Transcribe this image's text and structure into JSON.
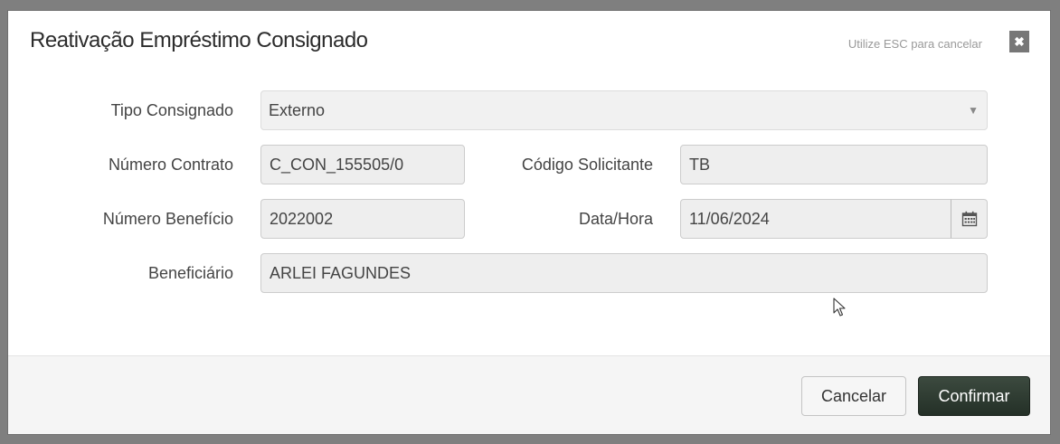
{
  "dialog": {
    "title": "Reativação Empréstimo Consignado",
    "esc_hint": "Utilize ESC para cancelar",
    "close_icon": "close-icon"
  },
  "form": {
    "tipo_consignado": {
      "label": "Tipo Consignado",
      "value": "Externo"
    },
    "numero_contrato": {
      "label": "Número Contrato",
      "value": "C_CON_155505/0"
    },
    "codigo_solicitante": {
      "label": "Código Solicitante",
      "value": "TB"
    },
    "numero_beneficio": {
      "label": "Número Benefício",
      "value": "2022002"
    },
    "data_hora": {
      "label": "Data/Hora",
      "value": "11/06/2024",
      "icon": "calendar-icon"
    },
    "beneficiario": {
      "label": "Beneficiário",
      "value": "ARLEI FAGUNDES"
    }
  },
  "footer": {
    "cancel_label": "Cancelar",
    "confirm_label": "Confirmar"
  },
  "colors": {
    "confirm_button": "#2b362d",
    "readonly_field": "#eeeeee",
    "backdrop": "#7f7f7f"
  }
}
